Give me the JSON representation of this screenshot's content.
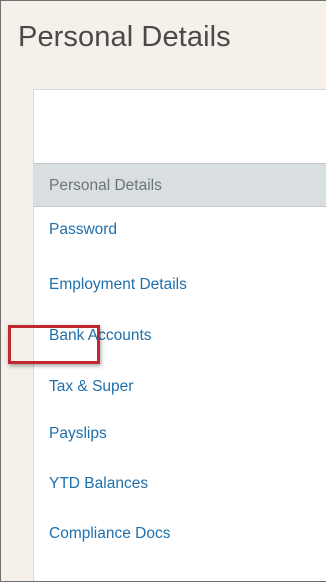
{
  "page": {
    "title": "Personal Details"
  },
  "nav": {
    "header": "Personal Details",
    "items": [
      {
        "label": "Password"
      },
      {
        "label": "Employment Details"
      },
      {
        "label": "Bank Accounts"
      },
      {
        "label": "Tax & Super"
      },
      {
        "label": "Payslips",
        "highlighted": true
      },
      {
        "label": "YTD Balances"
      },
      {
        "label": "Compliance Docs"
      }
    ]
  },
  "colors": {
    "background": "#f5f1ea",
    "link": "#1e6fab",
    "header_bg": "#d9dee0",
    "highlight": "#c0282f"
  }
}
